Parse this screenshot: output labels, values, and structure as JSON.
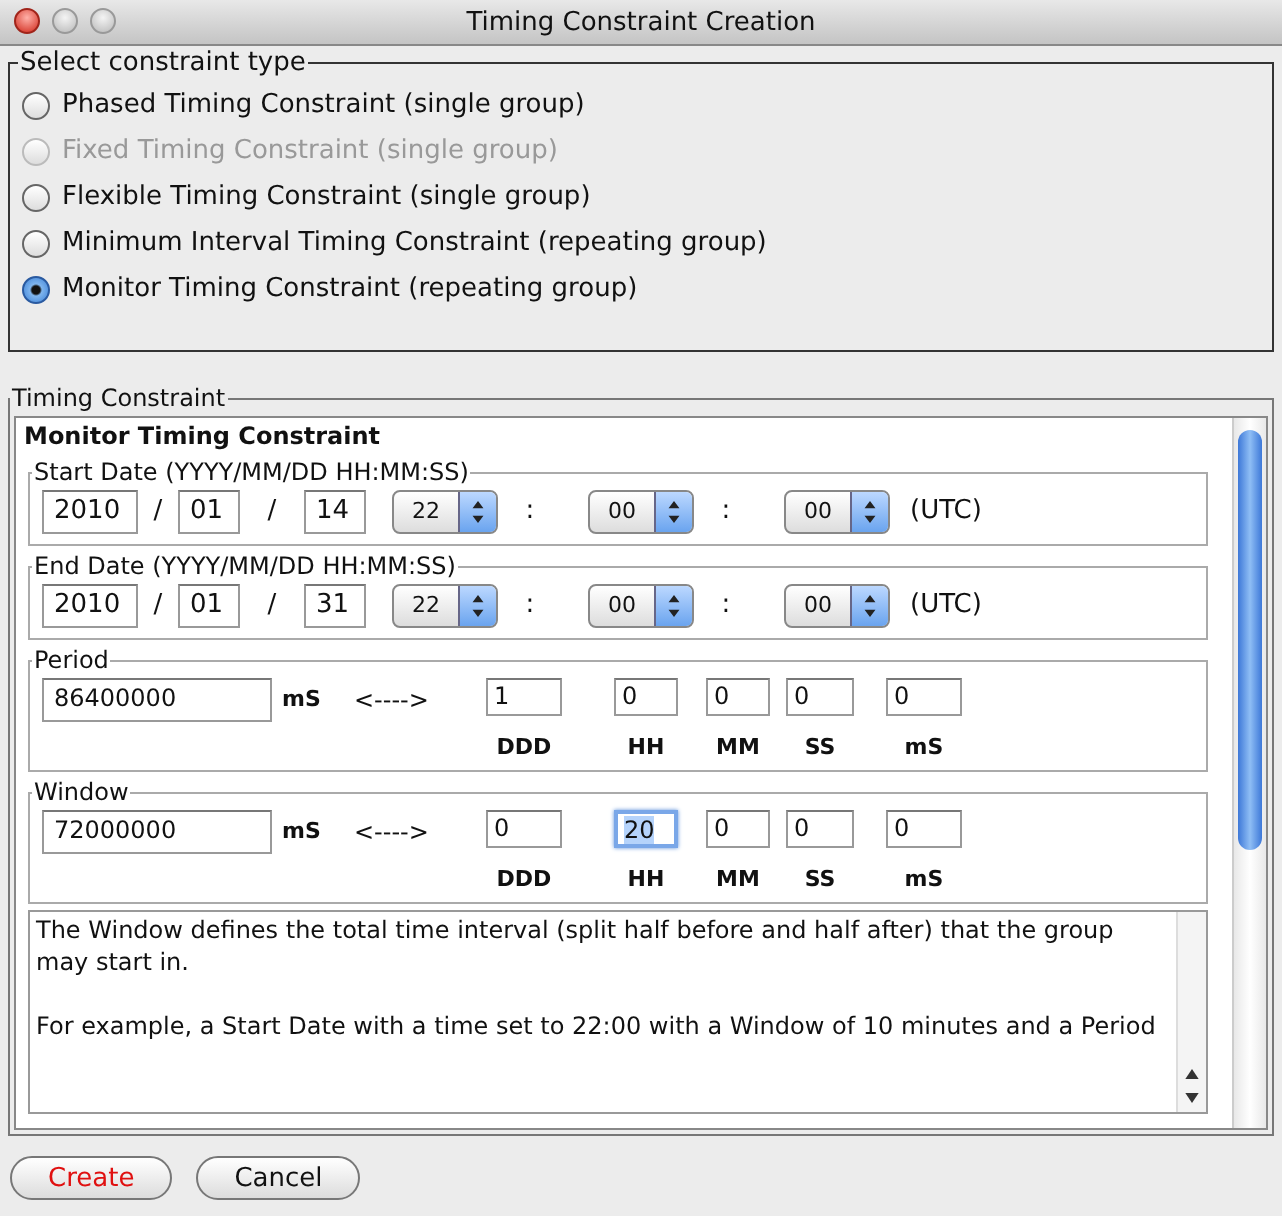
{
  "window": {
    "title": "Timing Constraint Creation"
  },
  "constraint_type": {
    "legend": "Select constraint type",
    "options": [
      {
        "label": "Phased Timing Constraint (single group)",
        "selected": false,
        "disabled": false
      },
      {
        "label": "Fixed Timing Constraint (single group)",
        "selected": false,
        "disabled": true
      },
      {
        "label": "Flexible Timing Constraint (single group)",
        "selected": false,
        "disabled": false
      },
      {
        "label": "Minimum Interval Timing Constraint (repeating group)",
        "selected": false,
        "disabled": false
      },
      {
        "label": "Monitor Timing Constraint (repeating group)",
        "selected": true,
        "disabled": false
      }
    ]
  },
  "timing": {
    "legend": "Timing Constraint",
    "heading": "Monitor Timing Constraint",
    "dates": [
      {
        "legend": "Start Date (YYYY/MM/DD HH:MM:SS)",
        "year": "2010",
        "month": "01",
        "day": "14",
        "hour": "22",
        "minute": "00",
        "second": "00",
        "date_sep": "/",
        "time_sep": ":",
        "zone": "(UTC)"
      },
      {
        "legend": "End Date (YYYY/MM/DD HH:MM:SS)",
        "year": "2010",
        "month": "01",
        "day": "31",
        "hour": "22",
        "minute": "00",
        "second": "00",
        "date_sep": "/",
        "time_sep": ":",
        "zone": "(UTC)"
      }
    ],
    "durations": [
      {
        "legend": "Period",
        "ms_value": "86400000",
        "unit": "mS",
        "arrow": "<---->",
        "fields": [
          {
            "value": "1",
            "label": "DDD",
            "focused": false
          },
          {
            "value": "0",
            "label": "HH",
            "focused": false
          },
          {
            "value": "0",
            "label": "MM",
            "focused": false
          },
          {
            "value": "0",
            "label": "SS",
            "focused": false
          },
          {
            "value": "0",
            "label": "mS",
            "focused": false
          }
        ]
      },
      {
        "legend": "Window",
        "ms_value": "72000000",
        "unit": "mS",
        "arrow": "<---->",
        "fields": [
          {
            "value": "0",
            "label": "DDD",
            "focused": false
          },
          {
            "value": "20",
            "label": "HH",
            "focused": true
          },
          {
            "value": "0",
            "label": "MM",
            "focused": false
          },
          {
            "value": "0",
            "label": "SS",
            "focused": false
          },
          {
            "value": "0",
            "label": "mS",
            "focused": false
          }
        ]
      }
    ],
    "description": [
      "The Window defines the total time interval (split half before and half after) that the group may start in.",
      "For example, a Start Date with a time set to 22:00 with a Window of 10 minutes and a Period"
    ]
  },
  "buttons": [
    {
      "label": "Create",
      "kind": "default"
    },
    {
      "label": "Cancel",
      "kind": "normal"
    }
  ]
}
